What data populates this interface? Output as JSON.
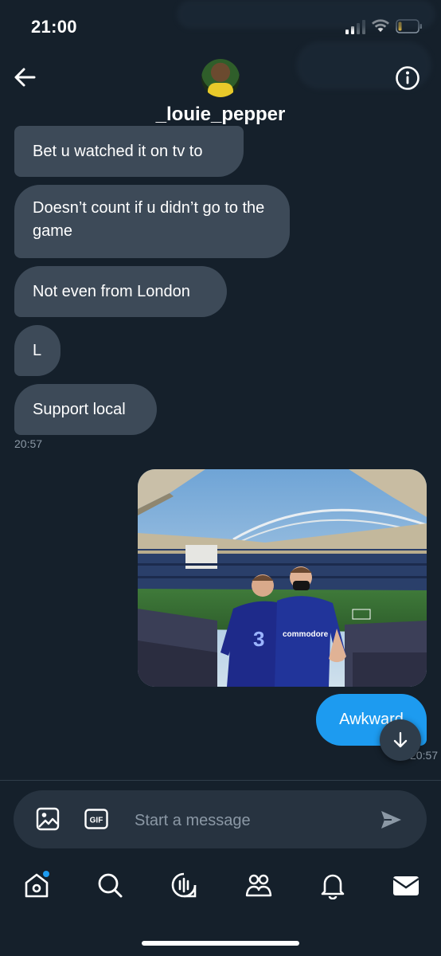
{
  "status_bar": {
    "time": "21:00"
  },
  "header": {
    "username": "_louie_pepper"
  },
  "messages": {
    "incoming": [
      "Bet u watched it on tv to",
      "Doesn’t count if u didn’t go to the game",
      "Not even from London",
      "L",
      "Support local"
    ],
    "incoming_time": "20:57",
    "outgoing_text": "Awkward",
    "outgoing_time": "20:57"
  },
  "photo": {
    "shirt_text_left": "3",
    "shirt_text_right": "commodore"
  },
  "composer": {
    "placeholder": "Start a message",
    "gif_label": "GIF"
  },
  "icons": {
    "back": "back-arrow-icon",
    "info": "info-icon",
    "image": "image-icon",
    "gif": "gif-icon",
    "send": "send-icon",
    "scroll_down": "arrow-down-icon",
    "nav": [
      "home-icon",
      "search-icon",
      "spaces-icon",
      "communities-icon",
      "notifications-icon",
      "messages-icon"
    ]
  },
  "colors": {
    "background": "#15202b",
    "incoming_bubble": "#3d4a58",
    "outgoing_bubble": "#1d9bf0",
    "secondary_text": "#8b98a5",
    "notification_dot": "#1d9bf0"
  }
}
